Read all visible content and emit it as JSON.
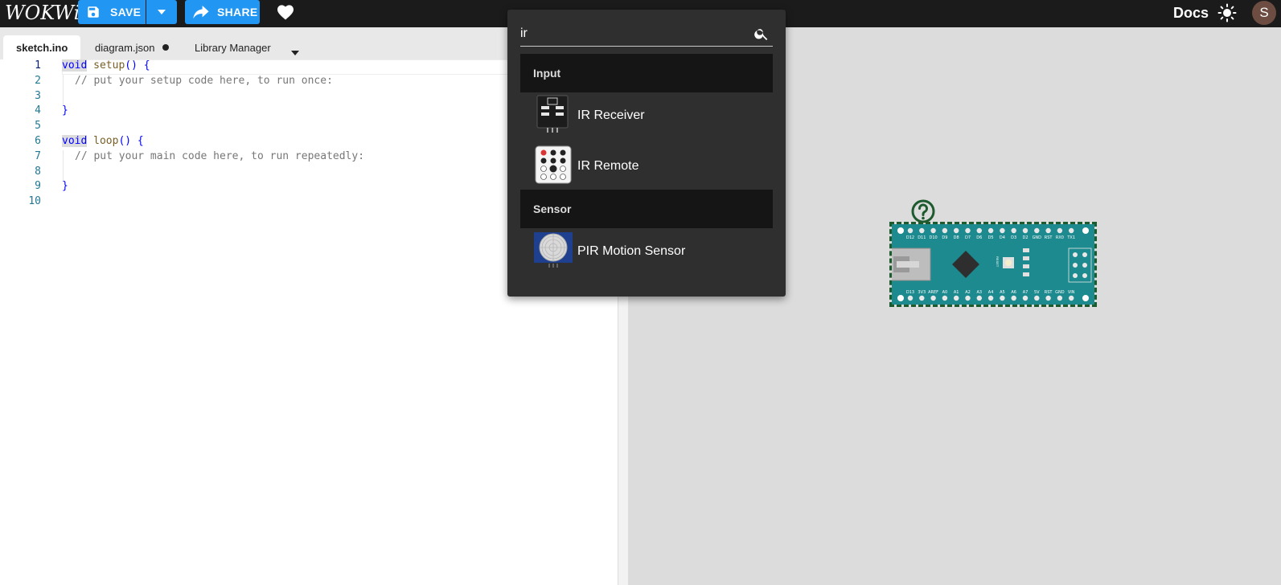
{
  "topbar": {
    "logo": "WOKWi",
    "save_label": "SAVE",
    "share_label": "SHARE",
    "docs_label": "Docs",
    "avatar_initial": "S"
  },
  "tabs": [
    {
      "label": "sketch.ino",
      "active": true
    },
    {
      "label": "diagram.json",
      "unsaved": true
    },
    {
      "label": "Library Manager"
    }
  ],
  "editor": {
    "lines": [
      {
        "n": "1"
      },
      {
        "n": "2"
      },
      {
        "n": "3"
      },
      {
        "n": "4"
      },
      {
        "n": "5"
      },
      {
        "n": "6"
      },
      {
        "n": "7"
      },
      {
        "n": "8"
      },
      {
        "n": "9"
      },
      {
        "n": "10"
      }
    ],
    "code": {
      "kw_void": "void",
      "setup_fn": "setup",
      "setup_open": "() {",
      "setup_comment": "// put your setup code here, to run once:",
      "close_brace": "}",
      "loop_fn": "loop",
      "loop_open": "() {",
      "loop_comment": "// put your main code here, to run repeatedly:"
    }
  },
  "part_search": {
    "query": "ir",
    "categories": [
      {
        "name": "Input",
        "items": [
          "IR Receiver",
          "IR Remote"
        ]
      },
      {
        "name": "Sensor",
        "items": [
          "PIR Motion Sensor"
        ]
      }
    ]
  },
  "board": {
    "top_pins": [
      "D12",
      "D11",
      "D10",
      "D9",
      "D8",
      "D7",
      "D6",
      "D5",
      "D4",
      "D3",
      "D2",
      "GND",
      "RST",
      "RX0",
      "TX1"
    ],
    "bottom_pins": [
      "D13",
      "3V3",
      "AREF",
      "A0",
      "A1",
      "A2",
      "A3",
      "A4",
      "A5",
      "A6",
      "A7",
      "5V",
      "RST",
      "GND",
      "VIN"
    ],
    "reset_label": "RESET",
    "led_labels": [
      "TX",
      "RX",
      "ON",
      "L"
    ]
  },
  "colors": {
    "accent": "#2196f3",
    "topbar": "#1b1b1b",
    "panel": "#2f2f2f",
    "board": "#1c8a8e"
  }
}
